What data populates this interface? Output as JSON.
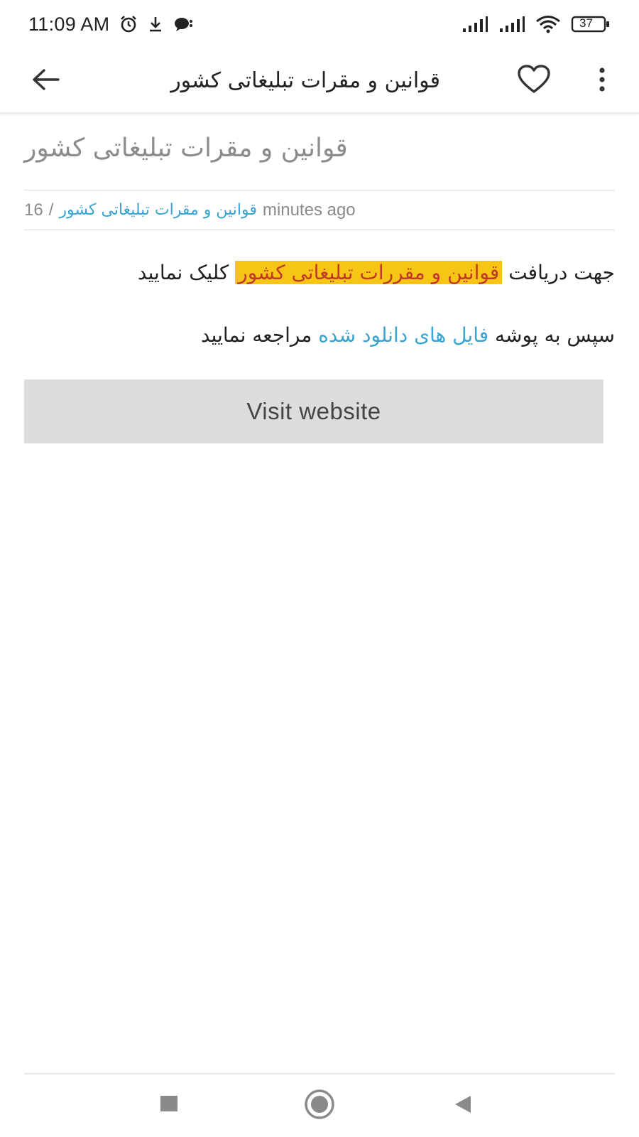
{
  "status_bar": {
    "time": "11:09 AM",
    "battery": "37",
    "icons": [
      "alarm-icon",
      "download-icon",
      "chat-bubble-icon",
      "signal-icon",
      "signal-icon",
      "wifi-icon",
      "battery-icon"
    ]
  },
  "app_bar": {
    "title": "قوانین و مقرات تبلیغاتی کشور",
    "icons": [
      "arrow-back-icon",
      "heart-outline-icon",
      "more-vert-icon"
    ]
  },
  "post": {
    "title": "قوانین و مقرات تبلیغاتی کشور",
    "meta": {
      "time_ago": "minutes ago",
      "category": "قوانین و مقرات تبلیغاتی کشور",
      "separator": "/",
      "count": "16"
    },
    "paragraph1": {
      "before": "جهت دریافت",
      "highlight": "قوانین و مقررات تبلیغاتی کشور",
      "after": "کلیک نمایید"
    },
    "paragraph2": {
      "before": "سپس به پوشه",
      "link": "فایل های دانلود شده",
      "after": "مراجعه نمایید"
    },
    "visit_button": "Visit website"
  },
  "colors": {
    "highlight_bg": "#f7c515",
    "highlight_text": "#c0392b",
    "link": "#3aa3d0",
    "button_bg": "#dddddd"
  },
  "nav_bar": {
    "icons": [
      "recents-square-icon",
      "home-circle-icon",
      "back-triangle-icon"
    ]
  }
}
